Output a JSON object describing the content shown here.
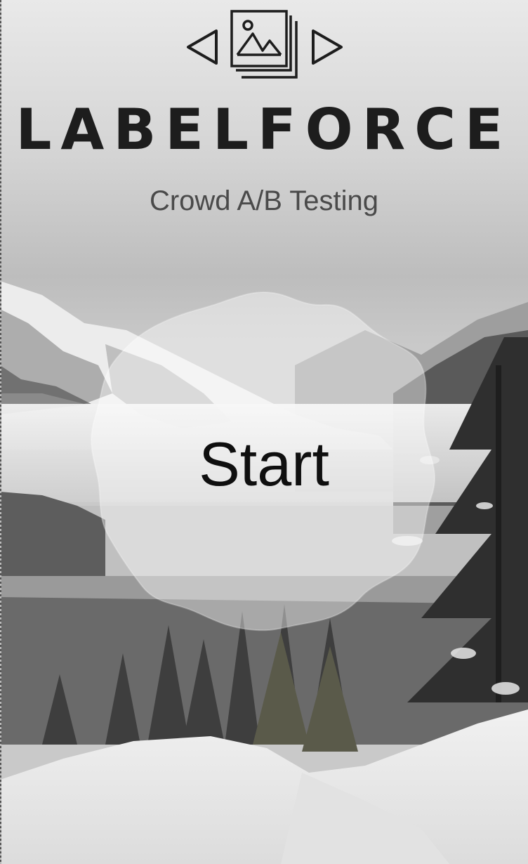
{
  "app": {
    "name": "LABELFORCE",
    "tagline": "Crowd A/B Testing"
  },
  "logo": {
    "icon": "image-stack-icon",
    "prev_icon": "triangle-left-icon",
    "next_icon": "triangle-right-icon"
  },
  "start": {
    "label": "Start"
  },
  "background": {
    "description_icon": "snowy-mountain-landscape"
  }
}
